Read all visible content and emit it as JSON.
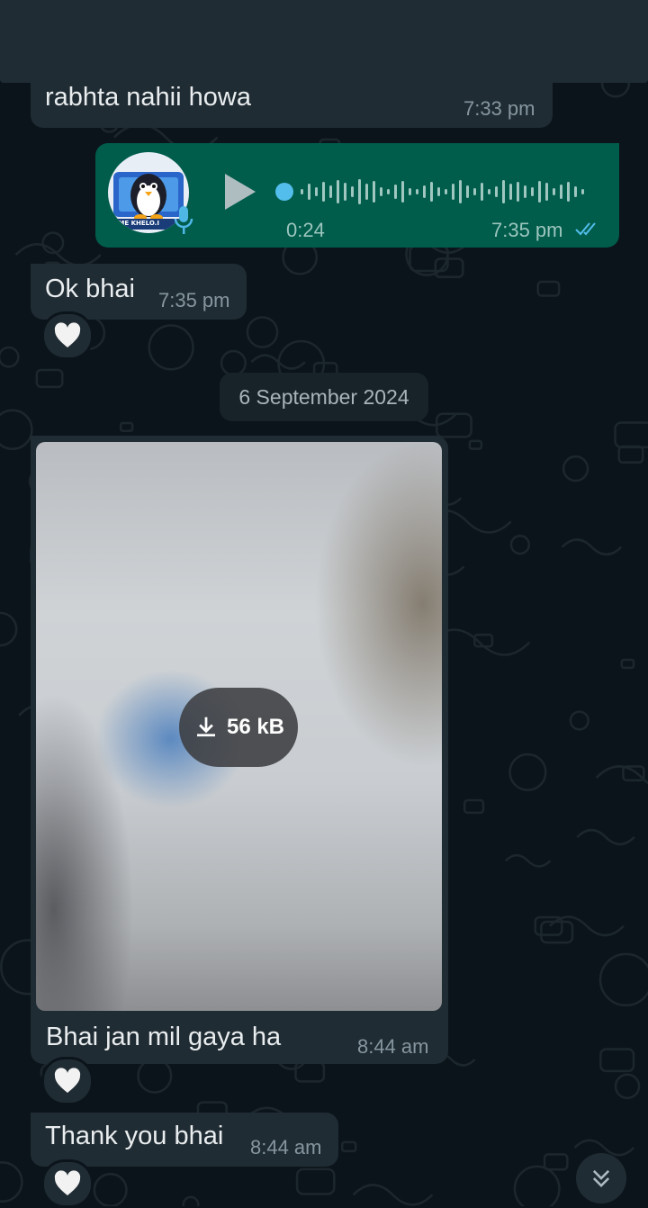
{
  "header": {
    "back_icon": "arrow-left-icon",
    "video_icon": "video-camera-icon",
    "call_icon": "phone-icon",
    "menu_icon": "more-vertical-icon"
  },
  "messages": {
    "m1": {
      "text": "rabhta nahii howa",
      "time": "7:33 pm"
    },
    "voice": {
      "duration": "0:24",
      "time": "7:35 pm",
      "status_icon": "double-check-icon",
      "avatar_text": "AME KHELO.I"
    },
    "m2": {
      "text": "Ok bhai",
      "time": "7:35 pm",
      "reaction": "🤍"
    },
    "date_separator": "6 September 2024",
    "image": {
      "size": "56 kB",
      "caption": "Bhai jan mil gaya ha",
      "time": "8:44 am",
      "reaction": "🤍"
    },
    "m3": {
      "text": "Thank you bhai",
      "time": "8:44 am",
      "reaction": "🤍"
    }
  },
  "colors": {
    "background": "#0b141a",
    "incoming_bubble": "#202c33",
    "outgoing_bubble": "#005c4b",
    "header": "#1f2c34",
    "read_ticks": "#53bdeb"
  }
}
